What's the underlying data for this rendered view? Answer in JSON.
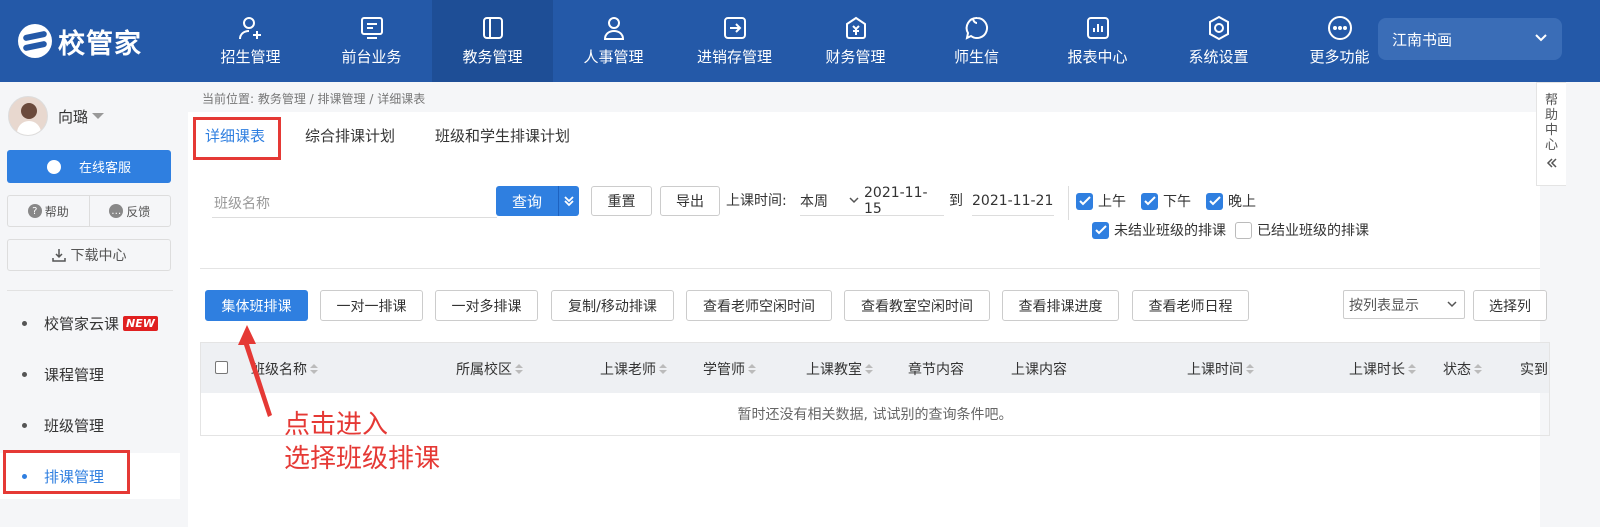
{
  "app": {
    "logo_text": "校管家",
    "campus": "江南书画"
  },
  "nav": [
    {
      "label": "招生管理",
      "icon": "user-add-icon"
    },
    {
      "label": "前台业务",
      "icon": "monitor-icon"
    },
    {
      "label": "教务管理",
      "icon": "book-icon",
      "active": true
    },
    {
      "label": "人事管理",
      "icon": "person-icon"
    },
    {
      "label": "进销存管理",
      "icon": "inventory-icon"
    },
    {
      "label": "财务管理",
      "icon": "yuan-icon"
    },
    {
      "label": "师生信",
      "icon": "chat-icon"
    },
    {
      "label": "报表中心",
      "icon": "report-icon"
    },
    {
      "label": "系统设置",
      "icon": "settings-icon"
    },
    {
      "label": "更多功能",
      "icon": "more-icon"
    }
  ],
  "sidebar": {
    "user_name": "向璐",
    "service_label": "在线客服",
    "help_label": "帮助",
    "feedback_label": "反馈",
    "download_label": "下载中心",
    "menu": [
      {
        "label": "校管家云课",
        "badge": "NEW"
      },
      {
        "label": "课程管理"
      },
      {
        "label": "班级管理"
      },
      {
        "label": "排课管理",
        "active": true
      }
    ]
  },
  "breadcrumb": "当前位置: 教务管理 / 排课管理 / 详细课表",
  "tabs": [
    "详细课表",
    "综合排课计划",
    "班级和学生排课计划"
  ],
  "filters": {
    "class_placeholder": "班级名称",
    "query_label": "查询",
    "reset_label": "重置",
    "export_label": "导出",
    "time_label": "上课时间:",
    "period": "本周",
    "date_from": "2021-11-15",
    "date_to_label": "到",
    "date_to": "2021-11-21",
    "checkboxes": [
      {
        "label": "上午",
        "checked": true
      },
      {
        "label": "下午",
        "checked": true
      },
      {
        "label": "晚上",
        "checked": true
      },
      {
        "label": "未结业班级的排课",
        "checked": true
      },
      {
        "label": "已结业班级的排课",
        "checked": false
      }
    ]
  },
  "actions": [
    "集体班排课",
    "一对一排课",
    "一对多排课",
    "复制/移动排课",
    "查看老师空闲时间",
    "查看教室空闲时间",
    "查看排课进度",
    "查看老师日程"
  ],
  "view_mode": "按列表显示",
  "select_columns_label": "选择列",
  "table": {
    "columns": [
      {
        "label": "班级名称",
        "sortable": true
      },
      {
        "label": "所属校区",
        "sortable": true
      },
      {
        "label": "上课老师",
        "sortable": true
      },
      {
        "label": "学管师",
        "sortable": true
      },
      {
        "label": "上课教室",
        "sortable": true
      },
      {
        "label": "章节内容",
        "sortable": false
      },
      {
        "label": "上课内容",
        "sortable": false
      },
      {
        "label": "上课时间",
        "sortable": true
      },
      {
        "label": "上课时长",
        "sortable": true
      },
      {
        "label": "状态",
        "sortable": true
      },
      {
        "label": "实到",
        "sortable": false
      }
    ],
    "empty_text": "暂时还没有相关数据, 试试别的查询条件吧。"
  },
  "help_center": [
    "帮",
    "助",
    "中",
    "心"
  ],
  "annotation": {
    "line1": "点击进入",
    "line2": "选择班级排课",
    "color": "#e53935"
  }
}
